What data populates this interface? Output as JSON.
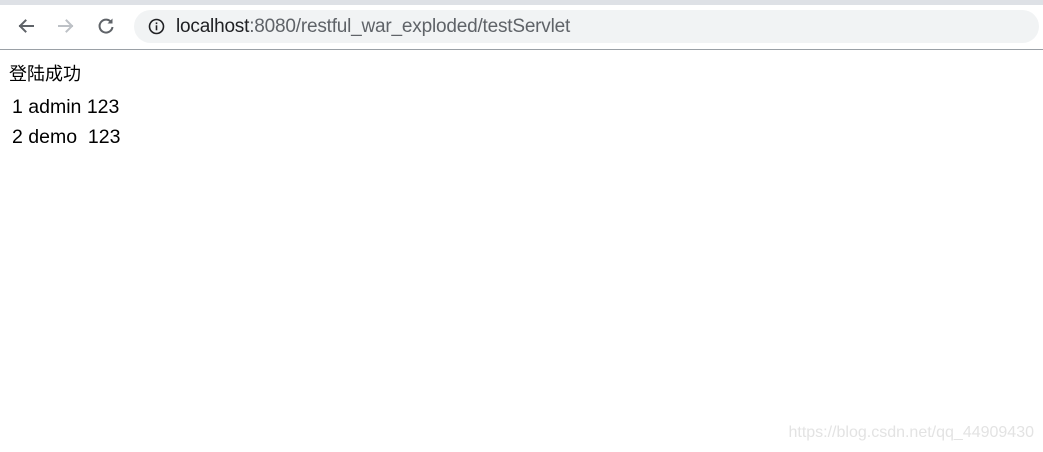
{
  "browser": {
    "url_host": "localhost",
    "url_rest": ":8080/restful_war_exploded/testServlet"
  },
  "page": {
    "message": "登陆成功",
    "users": [
      {
        "id": "1",
        "name": "admin",
        "password": "123"
      },
      {
        "id": "2",
        "name": "demo",
        "password": "123"
      }
    ]
  },
  "watermark": "https://blog.csdn.net/qq_44909430",
  "colors": {
    "toolbar_bg": "#ffffff",
    "omnibox_bg": "#f1f3f4",
    "icon": "#5f6368",
    "icon_disabled": "#bdc1c6"
  },
  "icons": [
    "back-arrow-icon",
    "forward-arrow-icon",
    "reload-icon",
    "info-icon"
  ]
}
